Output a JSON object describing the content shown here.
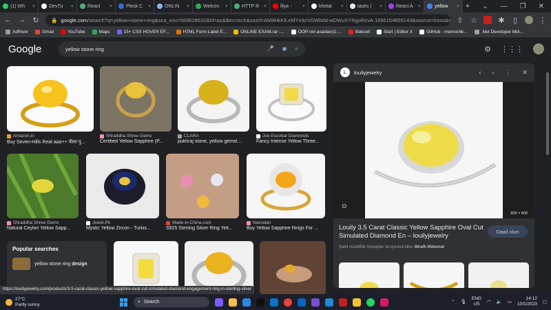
{
  "tabs": [
    {
      "label": "(1) Wh",
      "color": "#25d366"
    },
    {
      "label": "DevTu",
      "color": "#ffffff"
    },
    {
      "label": "React",
      "color": "#4caf7d"
    },
    {
      "label": "Plesk C",
      "color": "#2f6fd6"
    },
    {
      "label": "ONLIN",
      "color": "#8ab4f8"
    },
    {
      "label": "Welcon",
      "color": "#34a853"
    },
    {
      "label": "HTTP R",
      "color": "#4caf7d"
    },
    {
      "label": "lilya -",
      "color": "#ff0000"
    },
    {
      "label": "khetai",
      "color": "#ffffff"
    },
    {
      "label": "tasks |",
      "color": "#e8eaed"
    },
    {
      "label": "React A",
      "color": "#a142f4"
    },
    {
      "label": "yellow",
      "color": "#4285f4"
    }
  ],
  "address": {
    "host": "google.com",
    "path": "/search?q=yellow+stone+ring&sca_esv=569828632&hl=az&tbm=isch&sxsrf=AM9HkKlLeMYx9zVOWh0d-wDWuXYRgoRzvA:1696154855143&source=lnms&sa=X&ved=2ah..."
  },
  "bookmarks": [
    {
      "label": "AdRiver",
      "color": "#9aa0a6"
    },
    {
      "label": "Gmail",
      "color": "#ea4335"
    },
    {
      "label": "YouTube",
      "color": "#ff0000"
    },
    {
      "label": "Maps",
      "color": "#34a853"
    },
    {
      "label": "15+ CSS HOVER EF...",
      "color": "#7b61ff"
    },
    {
      "label": "HTML Form Label E...",
      "color": "#e37400"
    },
    {
      "label": "ONLINE EXAM.rar -...",
      "color": "#fbbc04"
    },
    {
      "label": "OOP-nin asasları(1-...",
      "color": "#ffffff"
    },
    {
      "label": "Bakcell",
      "color": "#e2231a"
    },
    {
      "label": "Start | Editor X",
      "color": "#ffffff"
    },
    {
      "label": "GitHub - memochk...",
      "color": "#ffffff"
    },
    {
      "label": ".Net Developer Mül...",
      "color": "#9aa0a6"
    }
  ],
  "google": {
    "logo": "Google",
    "query": "yellow stone ring"
  },
  "results": [
    {
      "source": "Amazon.in",
      "title": "Buy Seven-Hills Real aaa++ पीला पु...",
      "color": "#f59b20"
    },
    {
      "source": "Shraddha Shree Gems",
      "title": "Certified Yellow Sapphire (P...",
      "color": "#f48fb1"
    },
    {
      "source": "CLARA",
      "title": "pukhraj stone, yellow gemst...",
      "color": "#9aa0a6"
    },
    {
      "source": "Joe Escobar Diamonds",
      "title": "Fancy Intense Yellow Three...",
      "color": "#ffffff"
    },
    {
      "source": "Shraddha Shree Gems",
      "title": "Natural Ceylon Yellow Sapp...",
      "color": "#f48fb1"
    },
    {
      "source": "Jewel.Pk",
      "title": "Mystic Yellow Zircon - Turkis...",
      "color": "#ffffff"
    },
    {
      "source": "Made-in-China.com",
      "title": "S925 Sterling Silver Ring Yell...",
      "color": "#ea4335"
    },
    {
      "source": "Navratan",
      "title": "Buy Yellow Sapphire Rings For ...",
      "color": "#f48fb1"
    }
  ],
  "popular": {
    "heading": "Popular searches",
    "item_prefix": "yellow stone ring ",
    "item_bold": "design"
  },
  "panel": {
    "site": "louilyjewelry",
    "logo_letter": "L",
    "dimensions": "600 × 600",
    "title": "Louily 3.5 Carat Classic Yellow Sapphire Oval Cut Simulated Diamond En – louilyjewelry",
    "visit_label": "Daxil olun",
    "note_prefix": "Şəkil müəllifilik hüquqları ilə qoruna bilər. ",
    "note_link": "Ətraflı Məlumat"
  },
  "status_url": "https://louilyjewelry.com/products/3-5-carat-classic-yellow-sapphire-oval-cut-simulated-diamond-engagement-ring-in-sterling-silver",
  "taskbar": {
    "temp": "27°C",
    "weather": "Partly sunny",
    "search_label": "Search",
    "lang_top": "ENG",
    "lang_bottom": "US",
    "time": "14:12",
    "date": "10/1/2023"
  }
}
